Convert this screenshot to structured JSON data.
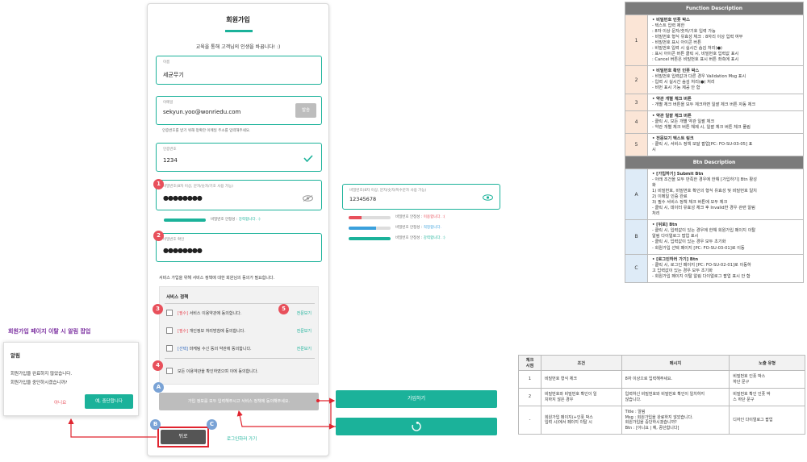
{
  "signup": {
    "title": "회원가입",
    "subtitle": "교육을 통해 고객님의 인생을 바꿉니다! :)",
    "name": {
      "label": "이름",
      "value": "세균무기"
    },
    "email": {
      "label": "이메일",
      "value": "sekyun.yoo@wonriedu.com",
      "send_btn": "발송",
      "help": "인증번호를 받기 위해 정확한 이메일 주소를 입력해주세요."
    },
    "code": {
      "label": "인증번호",
      "value": "1234"
    },
    "password": {
      "label": "비밀번호(8자 이상, 문자/숫자/기호 사용 가능)",
      "value": "●●●●●●●●",
      "strength_prefix": "비밀번호 안정성 :",
      "strength": "강력합니다. :)"
    },
    "password_confirm": {
      "label": "비밀번호 확인",
      "value": "●●●●●●●●"
    },
    "terms_intro": "서비스 가입을 위해 서비스 정책에 대한 회원님의 동의가 필요합니다.",
    "terms_title": "서비스 정책",
    "terms": [
      {
        "tag": "[필수]",
        "text": "서비스 이용약관에 동의합니다.",
        "link": "전문보기"
      },
      {
        "tag": "[필수]",
        "text": "개인정보 처리방침에 동의합니다.",
        "link": "전문보기"
      },
      {
        "tag": "[선택]",
        "text": "마케팅 수신 동의 약관에 동의합니다.",
        "link": "전문보기"
      }
    ],
    "all_agree": "모든 이용약관을 확인하였으며 이에 동의합니다.",
    "submit_disabled": "가입 정보를 모두 입력해주시고 서비스 정책에 동의해주세요.",
    "back_btn": "뒤로",
    "login_link": "로그인하러 가기"
  },
  "password_alt": {
    "label": "비밀번호(8자 이상, 문자/숫자/특수문자 사용 가능)",
    "value": "12345678",
    "prefix": "비밀번호 안정성 :",
    "levels": [
      {
        "text": "이용합니다. :(",
        "color": "#e8505b",
        "fill": 0.3
      },
      {
        "text": "적정합니다.",
        "color": "#3aa0dc",
        "fill": 0.65
      },
      {
        "text": "강력합니다. :)",
        "color": "#1bb29a",
        "fill": 1.0
      }
    ]
  },
  "buttons_right": {
    "submit_active": "가입하기"
  },
  "popup_section": {
    "heading": "회원가입 페이지 이탈 시 알림 팝업",
    "title": "알림",
    "line1": "회원가입을 완료하지 않았습니다.",
    "line2": "회원가입을 중단하시겠습니까?",
    "no": "아니요",
    "yes": "예, 중단합니다"
  },
  "markers": {
    "n1": "1",
    "n2": "2",
    "n3": "3",
    "n4": "4",
    "n5": "5",
    "a": "A",
    "b": "B",
    "c": "C"
  },
  "function_desc": {
    "header": "Function Description",
    "rows": [
      {
        "no": "1",
        "lines": [
          "• 비밀번호 인풋 박스",
          " - 텍스트 입력 제한",
          " : 8자 이상 문자/숫자/기호 입력 가능",
          " - 비밀번호 형식 유효성 체크 : 8자리 이상 입력 여부",
          " - 비밀번호 표시 아이콘 버튼",
          " : 비밀번호 입력 시 실시간 숨김 처리(●)",
          " : 표시 아이콘 버튼 클릭 시, 비밀번호 입력값 표시",
          " : Cancel 버튼은 비밀번호 표시 버튼 좌측에 표시"
        ]
      },
      {
        "no": "2",
        "lines": [
          "• 비밀번호 확인 인풋 박스",
          " - 비밀번호 입력값과 다른 경우 Validation Msg 표시",
          " - 입력 시 실시간 숨김 처리(●) 처리",
          " - 비번 표시 기능 제공 안 함"
        ]
      },
      {
        "no": "3",
        "lines": [
          "• 약관 개별 체크 버튼",
          " - 개별 체크 버튼을 모두 체크하면 일괄 체크 버튼 자동 체크"
        ]
      },
      {
        "no": "4",
        "lines": [
          "• 약관 일괄 체크 버튼",
          " - 클릭 시, 모든 개별 약관 일괄 체크",
          " - 약관 개별 체크 버튼 해제 시, 일괄 체크 버튼 체크 풀림"
        ]
      },
      {
        "no": "5",
        "lines": [
          "• 전문보기 텍스트 링크",
          " - 클릭 시, 서비스 정책 모달 팝업[PC: FO-SU-03-05] 표",
          "시"
        ]
      }
    ]
  },
  "btn_desc": {
    "header": "Btn Description",
    "rows": [
      {
        "no": "A",
        "lines": [
          "• [가입하기] Submit Btn",
          " - 아래 조건을 모두 만족한 경우에 한해 [가입하기] Btn 활성",
          "화",
          " 1) 비밀번호, 비밀번호 확인의 형식 유효성 및 비밀번호 일치",
          " 2) 이메일 인증 완료",
          " 3) 필수 서비스 정책 체크 버튼에 모두 체크",
          " - 클릭 시, 데이터 유효성 체크 후 Invalid한 경우 관련 알림",
          "처리"
        ]
      },
      {
        "no": "B",
        "lines": [
          "• [뒤로] Btn",
          " - 클릭 시, 입력값이 있는 경우에 한해 회원가입 페이지 이탈",
          "알림 다이얼로그 팝업 표시",
          " - 클릭 시, 입력값이 있는 경우 모두 초기화",
          " - 회원가입 선택 페이지 [PC: FO-SU-03-01]로 이동"
        ]
      },
      {
        "no": "C",
        "lines": [
          "• [로그인하러 가기] Btn",
          " - 클릭 시, 로그인 페이지 [PC: FO-SU-02-01]로 이동하",
          "고 입력값이 있는 경우 모두 초기화",
          " - 회원가입 페이지 이탈 알림 다이얼로그 팝업 표시 안 함"
        ]
      }
    ]
  },
  "msg_table": {
    "headers": [
      "체크\n시점",
      "조건",
      "메시지",
      "노출 유형"
    ],
    "rows": [
      {
        "no": "1",
        "cond": "비밀번호 형식 체크",
        "msg": "8자 이상으로 입력해주세요.",
        "type": "비밀번호 인풋 박스\n하단 문구"
      },
      {
        "no": "2",
        "cond": "비밀번호와 비밀번호 확인이 일\n치하지 않은 경우",
        "msg": "입력하신 비밀번호와 비밀번호 확인이 일치하지\n않습니다.",
        "type": "비밀번호 확인 인풋 박\n스 하단 문구"
      },
      {
        "no": "-",
        "cond": "회원가입 페이지(+인풋 박스\n입력 시)에서 페이지 이탈 시",
        "msg": "Title : 알림\nMsg : 회원가입을 완료하지 않았습니다.\n회원가입을 중단하시겠습니까?\nBtn : [아니요 | 예, 중단합니다]",
        "type": "디자인 다이얼로그 팝업"
      }
    ]
  },
  "colors": {
    "accent": "#1bb29a",
    "marker_red": "#e8505b",
    "marker_blue": "#7aa3d6",
    "arrow": "#e0242f"
  }
}
